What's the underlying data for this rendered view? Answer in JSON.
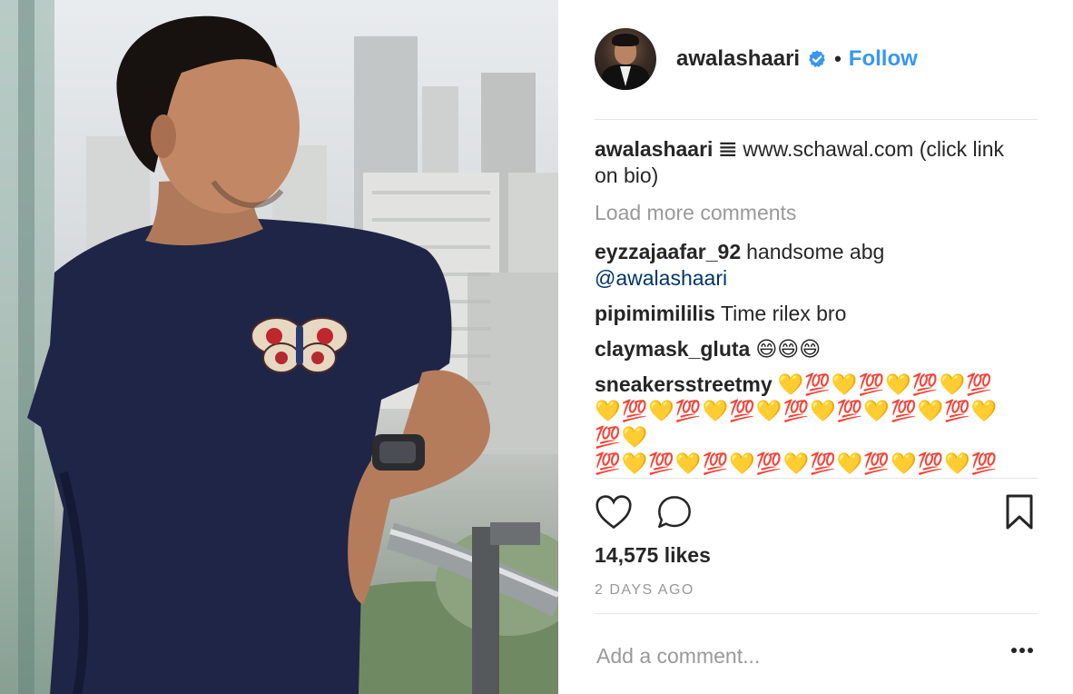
{
  "post": {
    "username": "awalashaari",
    "verified": true,
    "separator": "•",
    "follow_label": "Follow",
    "caption_user": "awalashaari",
    "caption_text": "𝌆 www.schawal.com (click link on bio)",
    "load_more_label": "Load more comments",
    "likes": "14,575 likes",
    "timestamp": "2 DAYS AGO",
    "comment_placeholder": "Add a comment...",
    "more_icon": "ellipsis-icon"
  },
  "comments": [
    {
      "user": "eyzzajaafar_92",
      "text": "handsome abg",
      "mention": "@awalashaari"
    },
    {
      "user": "pipimimililis",
      "text": "Time rilex bro"
    },
    {
      "user": "claymask_gluta",
      "text": "😄😄😄"
    },
    {
      "user": "sneakersstreetmy",
      "text": "💛💯💛💯💛💯💛💯",
      "text2": "💛💯💛💯💛💯💛💯💛💯💛💯💛💯💛💯💛",
      "text3": "💯💛💯💛💯💛💯💛💯💛💯💛💯💛💯💛💯",
      "text4": "💛💯💛💯💛💯💛💯💛💯💛💯💛💯💛💯💛"
    }
  ],
  "icons": {
    "like": "heart-icon",
    "comment": "comment-bubble-icon",
    "save": "bookmark-icon",
    "verified": "verified-badge-icon"
  },
  "colors": {
    "link_blue": "#3897f0",
    "mention_blue": "#003569",
    "muted_gray": "#999999",
    "text": "#262626",
    "verified_blue": "#3897f0"
  }
}
